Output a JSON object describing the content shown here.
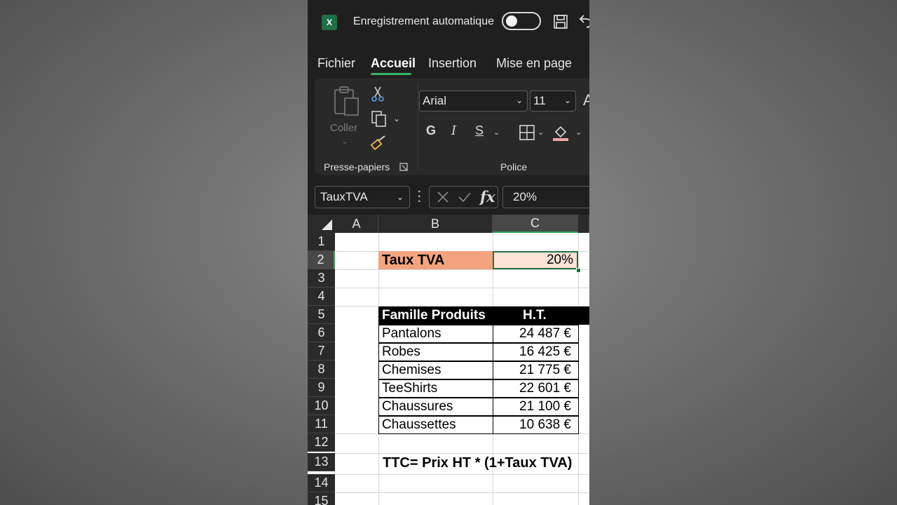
{
  "titlebar": {
    "app_icon_letter": "X",
    "autosave_label": "Enregistrement automatique",
    "autosave_on": false
  },
  "tabs": [
    {
      "label": "Fichier",
      "active": false
    },
    {
      "label": "Accueil",
      "active": true
    },
    {
      "label": "Insertion",
      "active": false
    },
    {
      "label": "Mise en page",
      "active": false
    }
  ],
  "ribbon": {
    "clipboard": {
      "paste_label": "Coller",
      "group_label": "Presse-papiers"
    },
    "font": {
      "font_name": "Arial",
      "font_size": "11",
      "bold": "G",
      "italic": "I",
      "underline": "S",
      "group_label": "Police",
      "grow_font": "A"
    }
  },
  "formula_bar": {
    "name_box": "TauxTVA",
    "fx": "fx",
    "formula": "20%"
  },
  "columns": [
    "A",
    "B",
    "C"
  ],
  "selected_column": "C",
  "rows": [
    "1",
    "2",
    "3",
    "4",
    "5",
    "6",
    "7",
    "8",
    "9",
    "10",
    "11",
    "12",
    "13",
    "14",
    "15"
  ],
  "selected_row": "2",
  "cells": {
    "tva_label": "Taux TVA",
    "tva_value": "20%",
    "table_header": {
      "famille": "Famille Produits",
      "ht": "H.T."
    },
    "table_rows": [
      {
        "famille": "Pantalons",
        "ht": "24 487 €"
      },
      {
        "famille": "Robes",
        "ht": "16 425 €"
      },
      {
        "famille": "Chemises",
        "ht": "21 775 €"
      },
      {
        "famille": "TeeShirts",
        "ht": "22 601 €"
      },
      {
        "famille": "Chaussures",
        "ht": "21 100 €"
      },
      {
        "famille": "Chaussettes",
        "ht": "10 638 €"
      }
    ],
    "formula_note": "TTC= Prix HT * (1+Taux TVA)"
  },
  "colors": {
    "accent_green": "#217346",
    "tva_label_bg": "#f3a47f",
    "tva_value_bg": "#fce4d6",
    "header_bg": "#000000"
  }
}
